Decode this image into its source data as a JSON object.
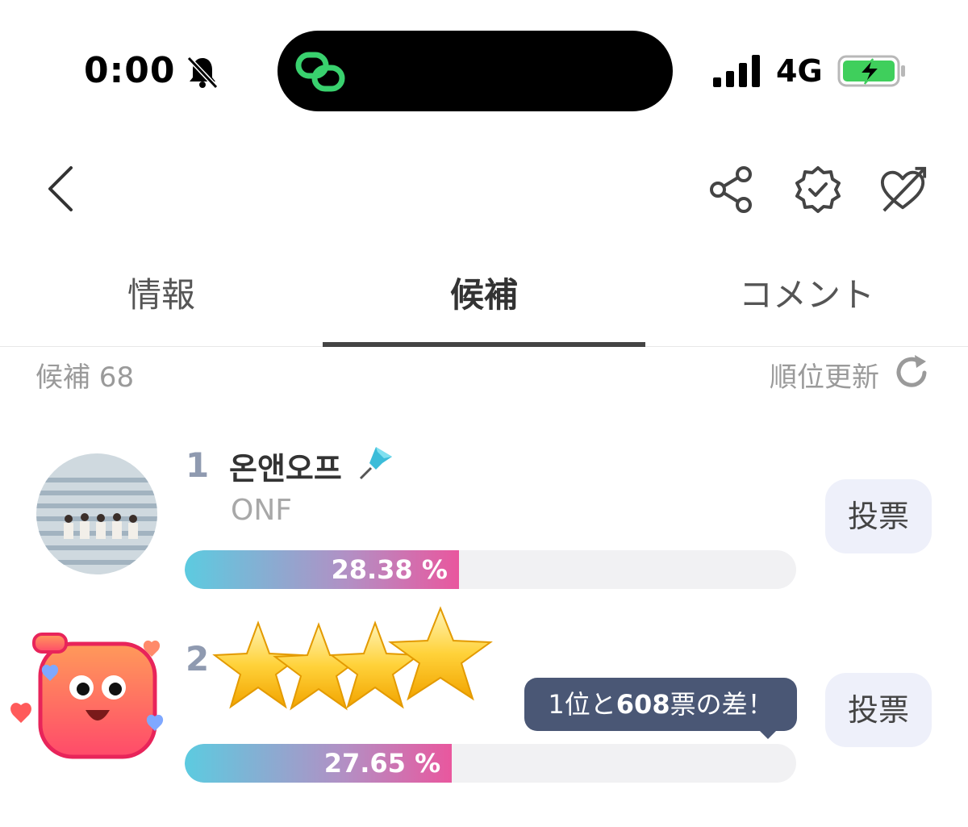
{
  "status_bar": {
    "time": "0:00",
    "network": "4G"
  },
  "tabs": [
    {
      "label": "情報"
    },
    {
      "label": "候補"
    },
    {
      "label": "コメント"
    }
  ],
  "list_header": {
    "count_label": "候補 68",
    "refresh_label": "順位更新"
  },
  "candidates": [
    {
      "rank": "1",
      "name": "온앤오프",
      "sub": "ONF",
      "percent": "28.38",
      "percent_unit": "%",
      "share": 28.38,
      "vote_label": "投票"
    },
    {
      "rank": "2",
      "name": "",
      "sub": "",
      "percent": "27.65",
      "percent_unit": "%",
      "share": 27.65,
      "vote_label": "投票"
    }
  ],
  "tooltip": {
    "prefix": "1位と",
    "number": "608",
    "suffix": "票の差！"
  },
  "colors": {
    "bar_start": "#5ccbe0",
    "bar_end": "#e9579e",
    "rank": "#8f9ab0",
    "vote_bg": "#eef0fa",
    "tooltip_bg": "#4a5775",
    "pin": "#3bbcd9"
  },
  "icons": [
    "bell-slash-icon",
    "link-icon",
    "signal-icon",
    "battery-charging-icon",
    "back-icon",
    "share-icon",
    "verified-badge-icon",
    "heart-arrow-icon",
    "refresh-icon",
    "pin-icon",
    "star-icon",
    "mascot-sticker"
  ]
}
